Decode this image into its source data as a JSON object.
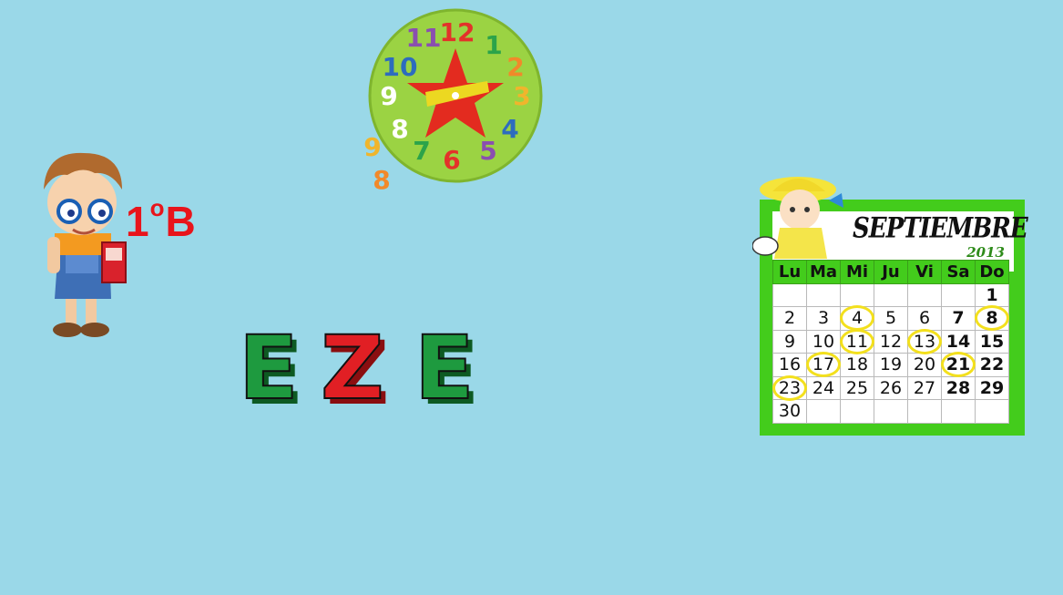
{
  "class_label": {
    "number": "1",
    "ordinal": "o",
    "group": "B"
  },
  "word": [
    "E",
    "Z",
    "E"
  ],
  "clock": {
    "numbers": [
      "12",
      "1",
      "2",
      "3",
      "4",
      "5",
      "6",
      "7",
      "8",
      "9",
      "10",
      "11"
    ],
    "loose_numbers": [
      "9",
      "8"
    ]
  },
  "calendar": {
    "month": "SEPTIEMBRE",
    "year": "2013",
    "weekdays": [
      "Lu",
      "Ma",
      "Mi",
      "Ju",
      "Vi",
      "Sa",
      "Do"
    ],
    "weeks": [
      [
        "",
        "",
        "",
        "",
        "",
        "",
        "1"
      ],
      [
        "2",
        "3",
        "4",
        "5",
        "6",
        "7",
        "8"
      ],
      [
        "9",
        "10",
        "11",
        "12",
        "13",
        "14",
        "15"
      ],
      [
        "16",
        "17",
        "18",
        "19",
        "20",
        "21",
        "22"
      ],
      [
        "23",
        "24",
        "25",
        "26",
        "27",
        "28",
        "29"
      ],
      [
        "30",
        "",
        "",
        "",
        "",
        "",
        ""
      ]
    ],
    "circled_days": [
      "4",
      "8",
      "11",
      "13",
      "17",
      "21",
      "23"
    ],
    "bold_days": [
      "1",
      "7",
      "8",
      "14",
      "15",
      "21",
      "22",
      "28",
      "29"
    ]
  },
  "colors": {
    "background": "#9ad8e8",
    "calendar_green": "#43cc1c",
    "circle_yellow": "#f3e01d",
    "label_red": "#e8141b"
  }
}
